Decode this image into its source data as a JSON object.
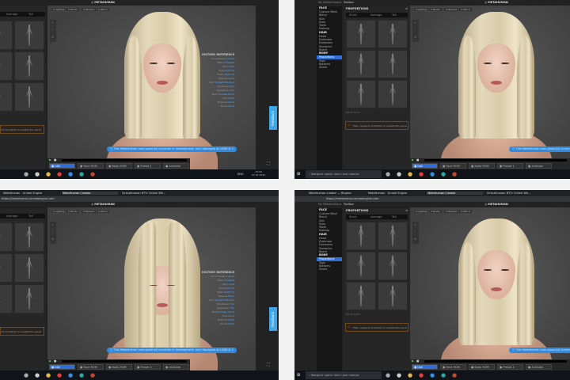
{
  "app": {
    "logo": "METAHUMAN",
    "feedback": "Feedback"
  },
  "browser": {
    "tabs": [
      "MetaHuman creator — Яндекс",
      "MetaHuman - Unreal Engine",
      "MetaHuman Creator",
      "Virtualhuman NTV: Online Wh..."
    ],
    "url": "https://metahuman.unrealengine.com"
  },
  "header": {
    "my_metahumans": "My MetaHumans",
    "character": "Toolbox"
  },
  "viewport_toolbar": [
    "Lighting",
    "Studio",
    "Medium",
    "LOD 0"
  ],
  "sidebar": {
    "sections": [
      {
        "title": "FACE",
        "items": [
          "Custom Mesh",
          "Blend",
          "Skin",
          "Eyes",
          "Teeth",
          "Makeup"
        ]
      },
      {
        "title": "HAIR",
        "items": [
          "Head",
          "Eyebrows",
          "Eyelashes",
          "Mustache",
          "Beard"
        ]
      },
      {
        "title": "BODY",
        "items": [
          "Proportions",
          "Tops",
          "Bottoms",
          "Shoes"
        ],
        "active": "Proportions"
      }
    ]
  },
  "presets_panel": {
    "title": "PROPORTIONS",
    "tabs": [
      "Short",
      "Average",
      "Tall"
    ],
    "footer": "Body type",
    "warning": "Main viewport animation to enable this panel"
  },
  "history": {
    "title": "HISTORY REFERENCE",
    "rows": [
      [
        "Face Preset",
        "Custom"
      ],
      [
        "Blend",
        "Enabled"
      ],
      [
        "Skin",
        "Light"
      ],
      [
        "Eyes",
        "Eyes 03"
      ],
      [
        "Teeth",
        "Teeth 01"
      ],
      [
        "Makeup",
        "None"
      ],
      [
        "Hair",
        "Straight Medium"
      ],
      [
        "Eyebrows",
        "Thin"
      ],
      [
        "Eyelashes",
        "Thin"
      ],
      [
        "Body",
        "Female Short"
      ],
      [
        "Tops",
        "None"
      ],
      [
        "Bottoms",
        "None"
      ],
      [
        "Shoes",
        "None"
      ]
    ]
  },
  "notice": "This MetaHuman uses groom(s) currently in development; only displayed at LOD0 & 1",
  "controls": [
    "Idle",
    "Face ROM",
    "Body ROM",
    "Preset 1",
    "Animate"
  ],
  "taskbar": {
    "search_placeholder": "Введите здесь текст для поиска",
    "time": "15:09",
    "date": "07.07.2022",
    "lang": "ENG"
  }
}
